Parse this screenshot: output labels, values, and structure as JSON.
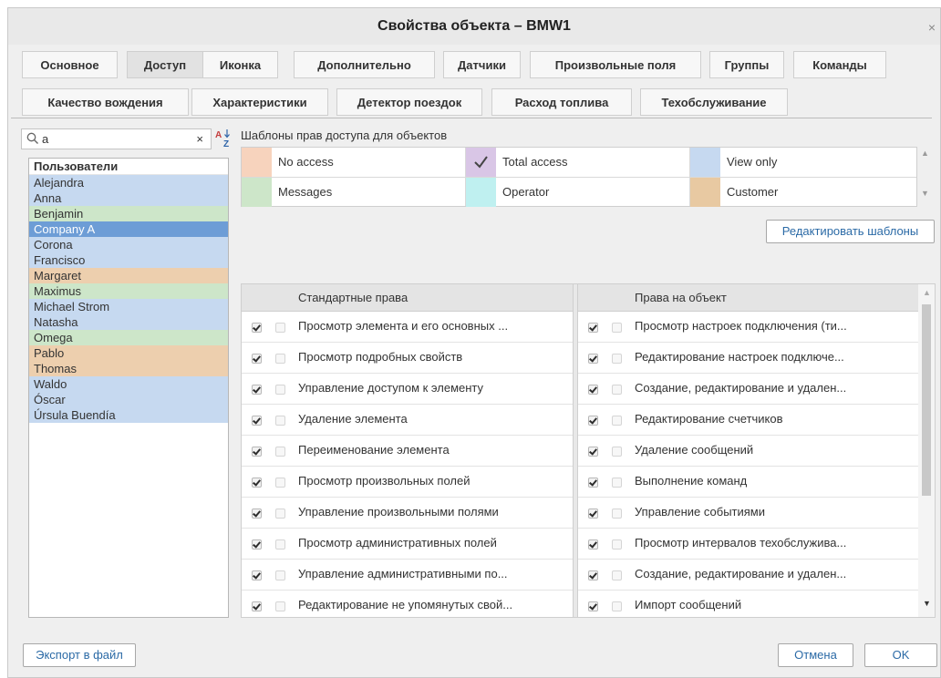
{
  "window": {
    "title": "Свойства объекта – BMW1",
    "close_glyph": "×"
  },
  "tabs_row1": [
    {
      "label": "Основное",
      "active": false
    },
    {
      "label": "Доступ",
      "active": true
    },
    {
      "label": "Иконка",
      "active": false
    },
    {
      "label": "Дополнительно",
      "active": false
    },
    {
      "label": "Датчики",
      "active": false
    },
    {
      "label": "Произвольные поля",
      "active": false
    },
    {
      "label": "Группы",
      "active": false
    },
    {
      "label": "Команды",
      "active": false
    }
  ],
  "tabs_row2": [
    {
      "label": "Качество вождения"
    },
    {
      "label": "Характеристики"
    },
    {
      "label": "Детектор поездок"
    },
    {
      "label": "Расход топлива"
    },
    {
      "label": "Техобслуживание"
    }
  ],
  "search": {
    "value": "a",
    "clear_glyph": "×"
  },
  "users": {
    "header": "Пользователи",
    "items": [
      {
        "name": "Alejandra",
        "color": "#c6d9f0"
      },
      {
        "name": "Anna",
        "color": "#c6d9f0"
      },
      {
        "name": "Benjamin",
        "color": "#cde6c9"
      },
      {
        "name": "Company A",
        "color": "#6d9dd6",
        "selected": true
      },
      {
        "name": "Corona",
        "color": "#c6d9f0"
      },
      {
        "name": "Francisco",
        "color": "#c6d9f0"
      },
      {
        "name": "Margaret",
        "color": "#edcfae"
      },
      {
        "name": "Maximus",
        "color": "#cde6c9"
      },
      {
        "name": "Michael Strom",
        "color": "#c6d9f0"
      },
      {
        "name": "Natasha",
        "color": "#c6d9f0"
      },
      {
        "name": "Omega",
        "color": "#cde6c9"
      },
      {
        "name": "Pablo",
        "color": "#edcfae"
      },
      {
        "name": "Thomas",
        "color": "#edcfae"
      },
      {
        "name": "Waldo",
        "color": "#c6d9f0"
      },
      {
        "name": "Óscar",
        "color": "#c6d9f0"
      },
      {
        "name": "Úrsula Buendía",
        "color": "#c6d9f0"
      }
    ]
  },
  "templates": {
    "label": "Шаблоны прав доступа для объектов",
    "items": [
      {
        "label": "No access",
        "color": "#f7d3bd"
      },
      {
        "label": "Total access",
        "color": "#d9c6e6",
        "checked": true
      },
      {
        "label": "View only",
        "color": "#c6d9f0"
      },
      {
        "label": "Messages",
        "color": "#cde6c9"
      },
      {
        "label": "Operator",
        "color": "#bff0f0"
      },
      {
        "label": "Customer",
        "color": "#e8c9a2"
      }
    ],
    "edit_button": "Редактировать шаблоны"
  },
  "rights": {
    "standard_header": "Стандартные права",
    "object_header": "Права на объект",
    "standard": [
      "Просмотр элемента и его основных ...",
      "Просмотр подробных свойств",
      "Управление доступом к элементу",
      "Удаление элемента",
      "Переименование элемента",
      "Просмотр произвольных полей",
      "Управление произвольными полями",
      "Просмотр административных полей",
      "Управление административными по...",
      "Редактирование не упомянутых свой..."
    ],
    "object": [
      "Просмотр настроек подключения (ти...",
      "Редактирование настроек подключе...",
      "Создание, редактирование и удален...",
      "Редактирование счетчиков",
      "Удаление сообщений",
      "Выполнение команд",
      "Управление событиями",
      "Просмотр интервалов техобслужива...",
      "Создание, редактирование и удален...",
      "Импорт сообщений"
    ]
  },
  "footer": {
    "export": "Экспорт в файл",
    "cancel": "Отмена",
    "ok": "OK"
  }
}
